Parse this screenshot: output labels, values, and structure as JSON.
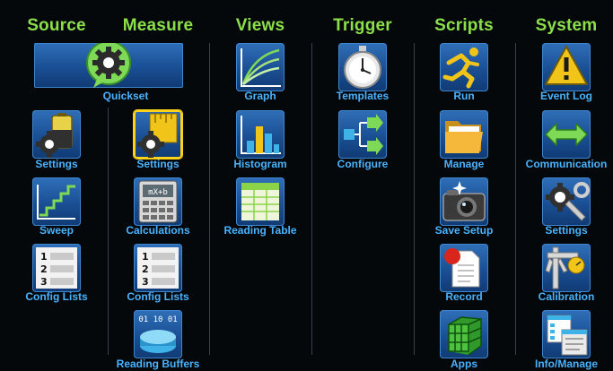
{
  "headers": {
    "source": "Source",
    "measure": "Measure",
    "views": "Views",
    "trigger": "Trigger",
    "scripts": "Scripts",
    "system": "System"
  },
  "source": {
    "quickset": "Quickset",
    "settings": "Settings",
    "sweep": "Sweep",
    "config_lists": "Config Lists"
  },
  "measure": {
    "settings": "Settings",
    "calculations": "Calculations",
    "config_lists": "Config Lists",
    "reading_buffers": "Reading Buffers"
  },
  "views": {
    "graph": "Graph",
    "histogram": "Histogram",
    "reading_table": "Reading Table"
  },
  "trigger": {
    "templates": "Templates",
    "configure": "Configure"
  },
  "scripts": {
    "run": "Run",
    "manage": "Manage",
    "save_setup": "Save Setup",
    "record": "Record",
    "apps": "Apps"
  },
  "system": {
    "event_log": "Event Log",
    "communication": "Communication",
    "settings": "Settings",
    "calibration": "Calibration",
    "info_manage": "Info/Manage"
  },
  "icon_glyphs": {
    "calc_formula": "mX+b",
    "list_1": "1",
    "list_2": "2",
    "list_3": "3",
    "buffer_bits": "01 10 01"
  },
  "colors": {
    "background": "#05080b",
    "header": "#8be04a",
    "label": "#49b3ff",
    "tile": "#1a4f94",
    "selected_border": "#ffd21a"
  }
}
